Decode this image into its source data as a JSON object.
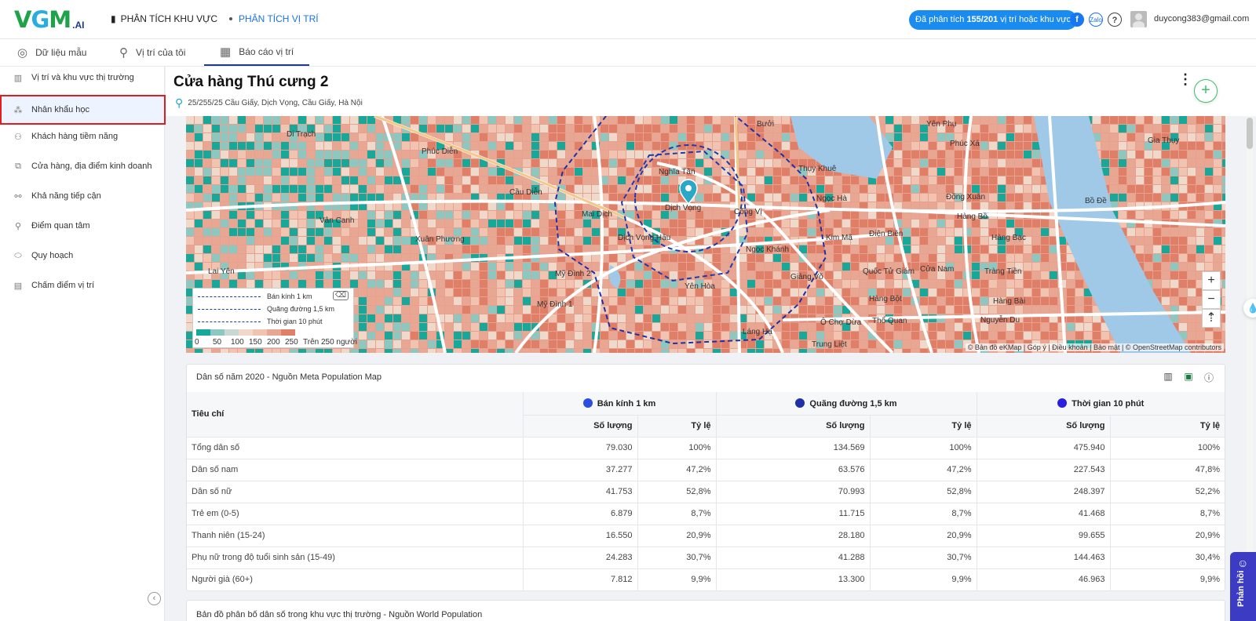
{
  "logo": {
    "main": "VGM",
    "suffix": ".AI"
  },
  "topnav": {
    "area_analysis": "PHÂN TÍCH KHU VỰC",
    "location_analysis": "PHÂN TÍCH VỊ TRÍ"
  },
  "quota": {
    "prefix": "Đã phân tích ",
    "count": "155/201",
    "suffix": " vị trí hoặc khu vực"
  },
  "social": {
    "facebook": "f",
    "zalo": "Zalo",
    "help": "?"
  },
  "user": {
    "email": "duycong383@gmail.com"
  },
  "tabs": [
    {
      "label": "Dữ liệu mẫu",
      "icon": "compass-icon"
    },
    {
      "label": "Vị trí của tôi",
      "icon": "map-pin-icon"
    },
    {
      "label": "Báo cáo vị trí",
      "icon": "dashboard-icon",
      "active": true
    }
  ],
  "sidebar": {
    "items": [
      {
        "label": "Vị trí và khu vực thị trường",
        "icon": "chart-icon"
      },
      {
        "label": "Nhân khẩu học",
        "icon": "people-icon",
        "active": true
      },
      {
        "label": "Khách hàng tiềm năng",
        "icon": "customer-icon"
      },
      {
        "label": "Cửa hàng, địa điểm kinh doanh",
        "icon": "store-icon"
      },
      {
        "label": "Khả năng tiếp cận",
        "icon": "route-icon"
      },
      {
        "label": "Điểm quan tâm",
        "icon": "poi-icon"
      },
      {
        "label": "Quy hoạch",
        "icon": "planning-icon"
      },
      {
        "label": "Chấm điểm vị trí",
        "icon": "score-icon"
      }
    ],
    "collapse": "‹"
  },
  "page": {
    "title": "Cửa hàng Thú cưng 2",
    "address": "25/255/25 Cầu Giấy, Dịch Vọng, Cầu Giấy, Hà Nội"
  },
  "map": {
    "legend": {
      "radius": "Bán kính  1 km",
      "road": "Quãng đường  1,5 km",
      "time": "Thời gian  10 phút",
      "ticks": [
        "0",
        "50",
        "100",
        "150",
        "200",
        "250",
        "Trên 250 người"
      ],
      "colors": [
        "#17a89a",
        "#8cc7c0",
        "#c9d8d2",
        "#eed9cb",
        "#f0c4b0",
        "#e8a793",
        "#e07f68"
      ]
    },
    "labels": [
      "Di Trạch",
      "Phúc Diễn",
      "Cầu Diễn",
      "Vân Canh",
      "Xuân Phương",
      "Lai Yên",
      "Mai Dịch",
      "Nghĩa Tân",
      "Dịch Vọng",
      "Cống Vị",
      "Dịch Vọng Hậu",
      "Ngọc Khánh",
      "Mỹ Đình 2",
      "Mỹ Đình 1",
      "Yên Hòa",
      "Giảng Võ",
      "Kim Mã",
      "Điện Biên",
      "Bưởi",
      "Thụy Khuê",
      "Ngọc Hà",
      "Yên Phụ",
      "Phúc Xá",
      "Đồng Xuân",
      "Hàng Bồ",
      "Hàng Bạc",
      "Quốc Tử Giám",
      "Cửa Nam",
      "Tràng Tiền",
      "Hàng Bột",
      "Hàng Bài",
      "Ô Chợ Dừa",
      "Thổ Quan",
      "Nguyễn Du",
      "Láng Hạ",
      "Trung Liệt",
      "Bồ Đề",
      "Gia Thụy"
    ],
    "zoom_in": "+",
    "zoom_out": "−",
    "compass": "⇡",
    "attribution": "© Bản đồ eKMap | Góp ý | Điều khoản | Bảo mật | © OpenStreetMap contributors"
  },
  "population_table": {
    "title": "Dân số năm 2020 - Nguồn Meta Population Map",
    "criteria_header": "Tiêu chí",
    "groups": [
      {
        "label": "Bán kính 1 km",
        "color": "#2b4de0"
      },
      {
        "label": "Quãng đường 1,5 km",
        "color": "#1e2fa8"
      },
      {
        "label": "Thời gian 10 phút",
        "color": "#2a1ee0"
      }
    ],
    "sub_headers": {
      "count": "Số lượng",
      "ratio": "Tỷ lệ"
    },
    "rows": [
      {
        "label": "Tổng dân số",
        "v": [
          "79.030",
          "100%",
          "134.569",
          "100%",
          "475.940",
          "100%"
        ]
      },
      {
        "label": "Dân số nam",
        "v": [
          "37.277",
          "47,2%",
          "63.576",
          "47,2%",
          "227.543",
          "47,8%"
        ]
      },
      {
        "label": "Dân số nữ",
        "v": [
          "41.753",
          "52,8%",
          "70.993",
          "52,8%",
          "248.397",
          "52,2%"
        ]
      },
      {
        "label": "Trẻ em (0-5)",
        "v": [
          "6.879",
          "8,7%",
          "11.715",
          "8,7%",
          "41.468",
          "8,7%"
        ]
      },
      {
        "label": "Thanh niên (15-24)",
        "v": [
          "16.550",
          "20,9%",
          "28.180",
          "20,9%",
          "99.655",
          "20,9%"
        ]
      },
      {
        "label": "Phụ nữ trong độ tuổi sinh sản (15-49)",
        "v": [
          "24.283",
          "30,7%",
          "41.288",
          "30,7%",
          "144.463",
          "30,4%"
        ]
      },
      {
        "label": "Người già (60+)",
        "v": [
          "7.812",
          "9,9%",
          "13.300",
          "9,9%",
          "46.963",
          "9,9%"
        ]
      }
    ]
  },
  "second_card": {
    "title": "Bản đồ phân bố dân số trong khu vực thị trường - Nguồn World Population"
  },
  "feedback": {
    "label": "Phản hồi"
  }
}
